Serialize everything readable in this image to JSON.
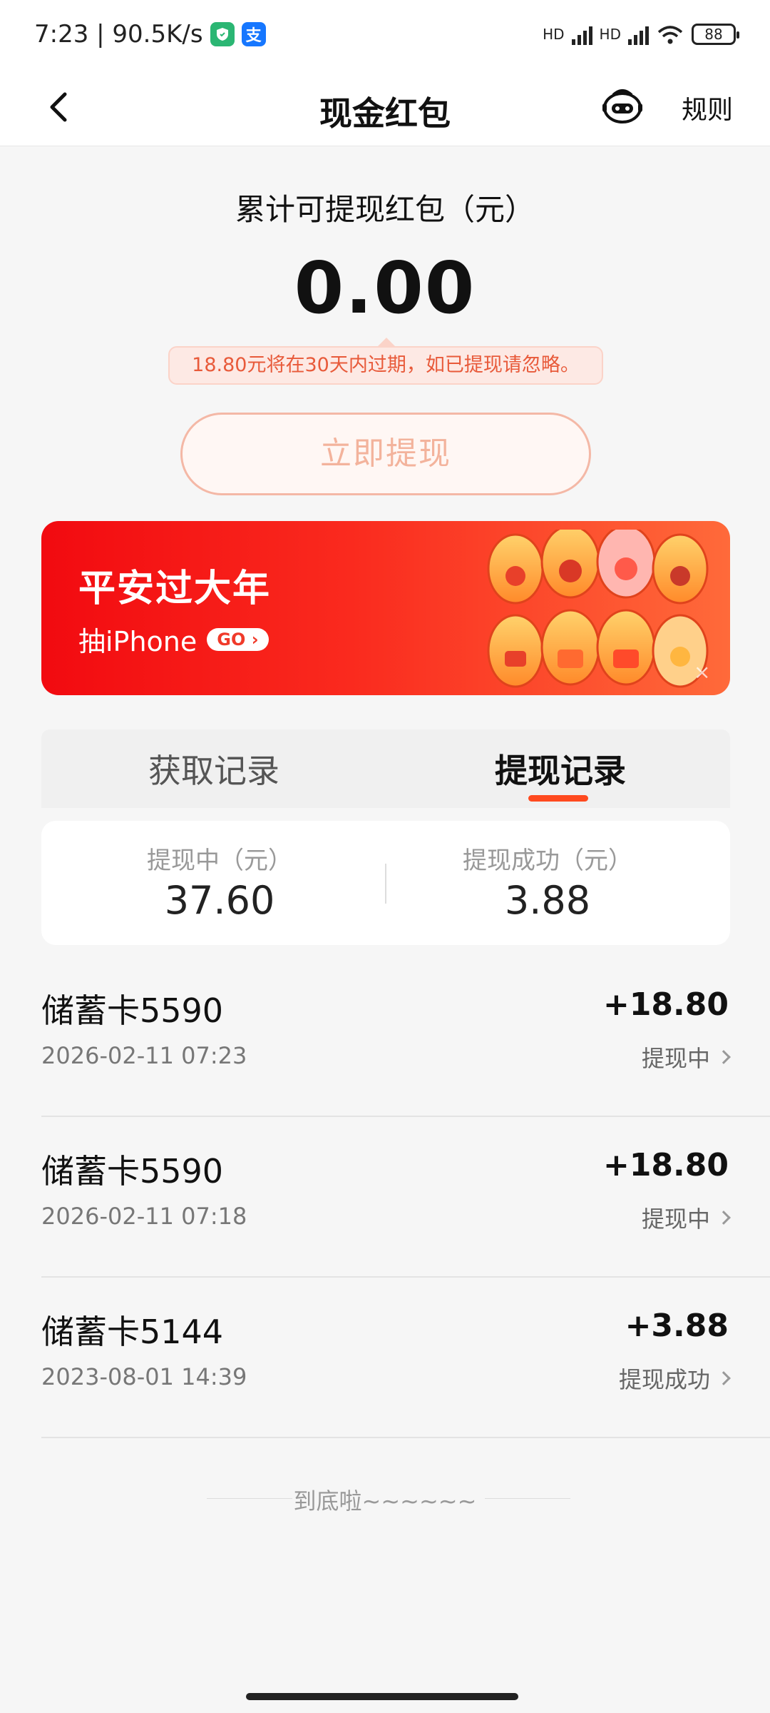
{
  "status_bar": {
    "time_speed": "7:23 | 90.5K/s",
    "signal1_label": "HD",
    "signal2_label": "HD",
    "battery": "88"
  },
  "nav": {
    "title": "现金红包",
    "rules_label": "规则"
  },
  "summary": {
    "label": "累计可提现红包（元）",
    "amount": "0.00",
    "expire_tip": "18.80元将在30天内过期，如已提现请忽略。",
    "withdraw_button": "立即提现"
  },
  "banner": {
    "title": "平安过大年",
    "subtitle": "抽iPhone",
    "go_label": "GO",
    "close_label": "×"
  },
  "tabs": [
    {
      "label": "获取记录",
      "active": false
    },
    {
      "label": "提现记录",
      "active": true
    }
  ],
  "stats": {
    "pending_label": "提现中（元）",
    "pending_value": "37.60",
    "success_label": "提现成功（元）",
    "success_value": "3.88"
  },
  "records": [
    {
      "title": "储蓄卡5590",
      "time": "2026-02-11 07:23",
      "amount": "+18.80",
      "status": "提现中"
    },
    {
      "title": "储蓄卡5590",
      "time": "2026-02-11 07:18",
      "amount": "+18.80",
      "status": "提现中"
    },
    {
      "title": "储蓄卡5144",
      "time": "2023-08-01 14:39",
      "amount": "+3.88",
      "status": "提现成功"
    }
  ],
  "footer": {
    "end_text": "到底啦~~~~~~"
  },
  "colors": {
    "accent": "#ff4a1f",
    "banner_start": "#f20a10",
    "banner_end": "#ff6a3a",
    "tip_text": "#e85a3a"
  },
  "icons": {
    "back": "chevron-left-icon",
    "service": "robot-service-icon",
    "record_chevron": "chevron-right-icon"
  }
}
